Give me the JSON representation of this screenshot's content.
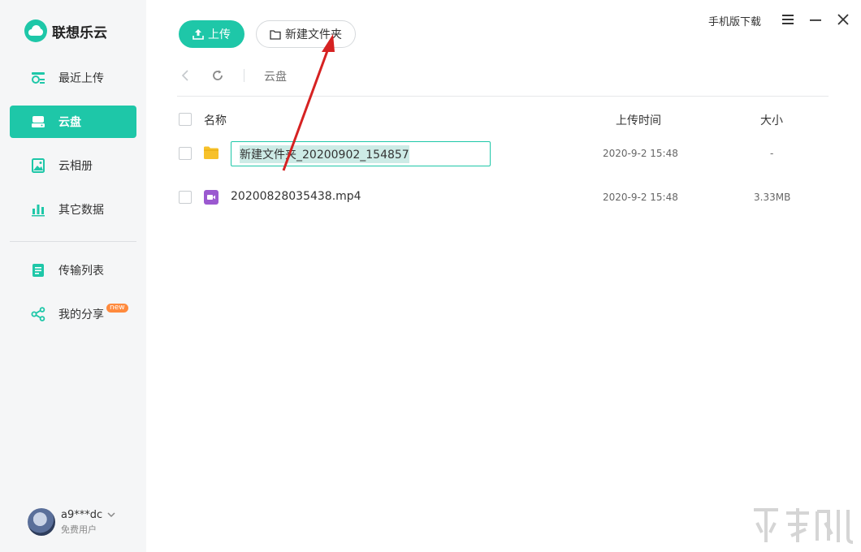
{
  "brand": {
    "name": "联想乐云"
  },
  "sidebar": {
    "items": [
      {
        "label": "最近上传",
        "icon": "recent-upload-icon"
      },
      {
        "label": "云盘",
        "icon": "cloud-drive-icon",
        "active": true
      },
      {
        "label": "云相册",
        "icon": "photo-album-icon"
      },
      {
        "label": "其它数据",
        "icon": "bar-chart-icon"
      },
      {
        "label": "传输列表",
        "icon": "transfer-list-icon"
      },
      {
        "label": "我的分享",
        "icon": "share-icon",
        "badge": "new"
      }
    ]
  },
  "user": {
    "name": "a9***dc",
    "type": "免费用户"
  },
  "toolbar": {
    "upload_label": "上传",
    "new_folder_label": "新建文件夹"
  },
  "header": {
    "mobile_download": "手机版下载"
  },
  "breadcrumb": {
    "current": "云盘"
  },
  "table": {
    "columns": {
      "name": "名称",
      "time": "上传时间",
      "size": "大小"
    },
    "rows": [
      {
        "name": "新建文件夹_20200902_154857",
        "time": "2020-9-2 15:48",
        "size": "-",
        "type": "folder",
        "editing": true
      },
      {
        "name": "20200828035438.mp4",
        "time": "2020-9-2 15:48",
        "size": "3.33MB",
        "type": "video"
      }
    ]
  },
  "colors": {
    "accent": "#1ec7a8",
    "annotation_arrow": "#d62222",
    "folder": "#f7c12a",
    "video": "#9b59d0"
  }
}
